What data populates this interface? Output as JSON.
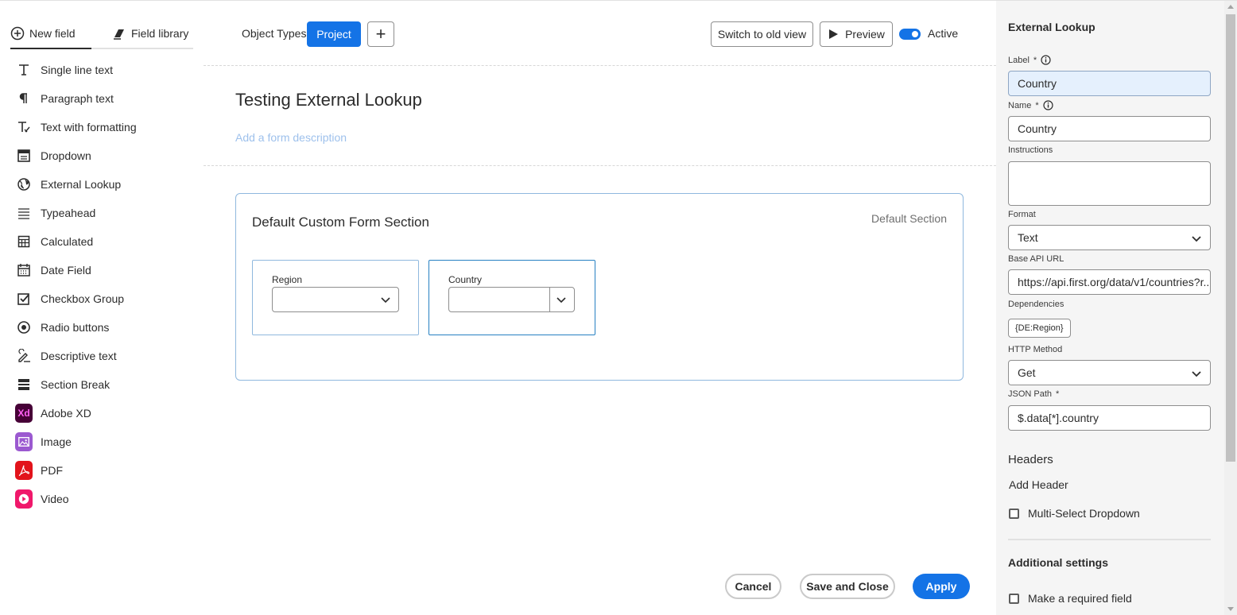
{
  "left_panel": {
    "tabs": [
      {
        "label": "New field",
        "icon": "plus-circle-icon",
        "active": true
      },
      {
        "label": "Field library",
        "icon": "library-icon",
        "active": false
      }
    ],
    "fields": [
      {
        "label": "Single line text",
        "icon": "text-t-icon"
      },
      {
        "label": "Paragraph text",
        "icon": "paragraph-icon"
      },
      {
        "label": "Text with formatting",
        "icon": "text-format-icon"
      },
      {
        "label": "Dropdown",
        "icon": "dropdown-icon"
      },
      {
        "label": "External Lookup",
        "icon": "globe-icon"
      },
      {
        "label": "Typeahead",
        "icon": "typeahead-icon"
      },
      {
        "label": "Calculated",
        "icon": "calculator-icon"
      },
      {
        "label": "Date Field",
        "icon": "calendar-icon"
      },
      {
        "label": "Checkbox Group",
        "icon": "checkbox-icon"
      },
      {
        "label": "Radio buttons",
        "icon": "radio-icon"
      },
      {
        "label": "Descriptive text",
        "icon": "descriptive-text-icon"
      },
      {
        "label": "Section Break",
        "icon": "section-break-icon"
      },
      {
        "label": "Adobe XD",
        "icon": "adobe-xd-icon",
        "badge": "Xd"
      },
      {
        "label": "Image",
        "icon": "image-icon"
      },
      {
        "label": "PDF",
        "icon": "pdf-icon"
      },
      {
        "label": "Video",
        "icon": "video-icon"
      }
    ]
  },
  "topbar": {
    "object_types_label": "Object Types",
    "project_button": "Project",
    "switch_old_view": "Switch to old view",
    "preview": "Preview",
    "active_label": "Active",
    "active": true
  },
  "form": {
    "title": "Testing External Lookup",
    "description_placeholder": "Add a form description"
  },
  "section": {
    "title": "Default Custom Form Section",
    "tag": "Default Section",
    "fields": [
      {
        "label": "Region"
      },
      {
        "label": "Country"
      }
    ]
  },
  "actions": {
    "cancel": "Cancel",
    "save_close": "Save and Close",
    "apply": "Apply"
  },
  "right_panel": {
    "title": "External Lookup",
    "label_label": "Label",
    "label_value": "Country",
    "name_label": "Name",
    "name_value": "Country",
    "required_mark": "*",
    "instructions_label": "Instructions",
    "format_label": "Format",
    "format_value": "Text",
    "base_api_label": "Base API URL",
    "base_api_value": "https://api.first.org/data/v1/countries?r...",
    "dependencies_label": "Dependencies",
    "dependency_tag": "{DE:Region}",
    "http_method_label": "HTTP Method",
    "http_method_value": "Get",
    "json_path_label": "JSON Path",
    "json_path_value": "$.data[*].country",
    "headers_heading": "Headers",
    "add_header": "Add Header",
    "multi_select": "Multi-Select Dropdown",
    "additional_settings": "Additional settings",
    "required_field": "Make a required field"
  },
  "colors": {
    "accent": "#1473e6",
    "section_border": "#8fb8de",
    "panel_bg": "#f5f5f5"
  }
}
